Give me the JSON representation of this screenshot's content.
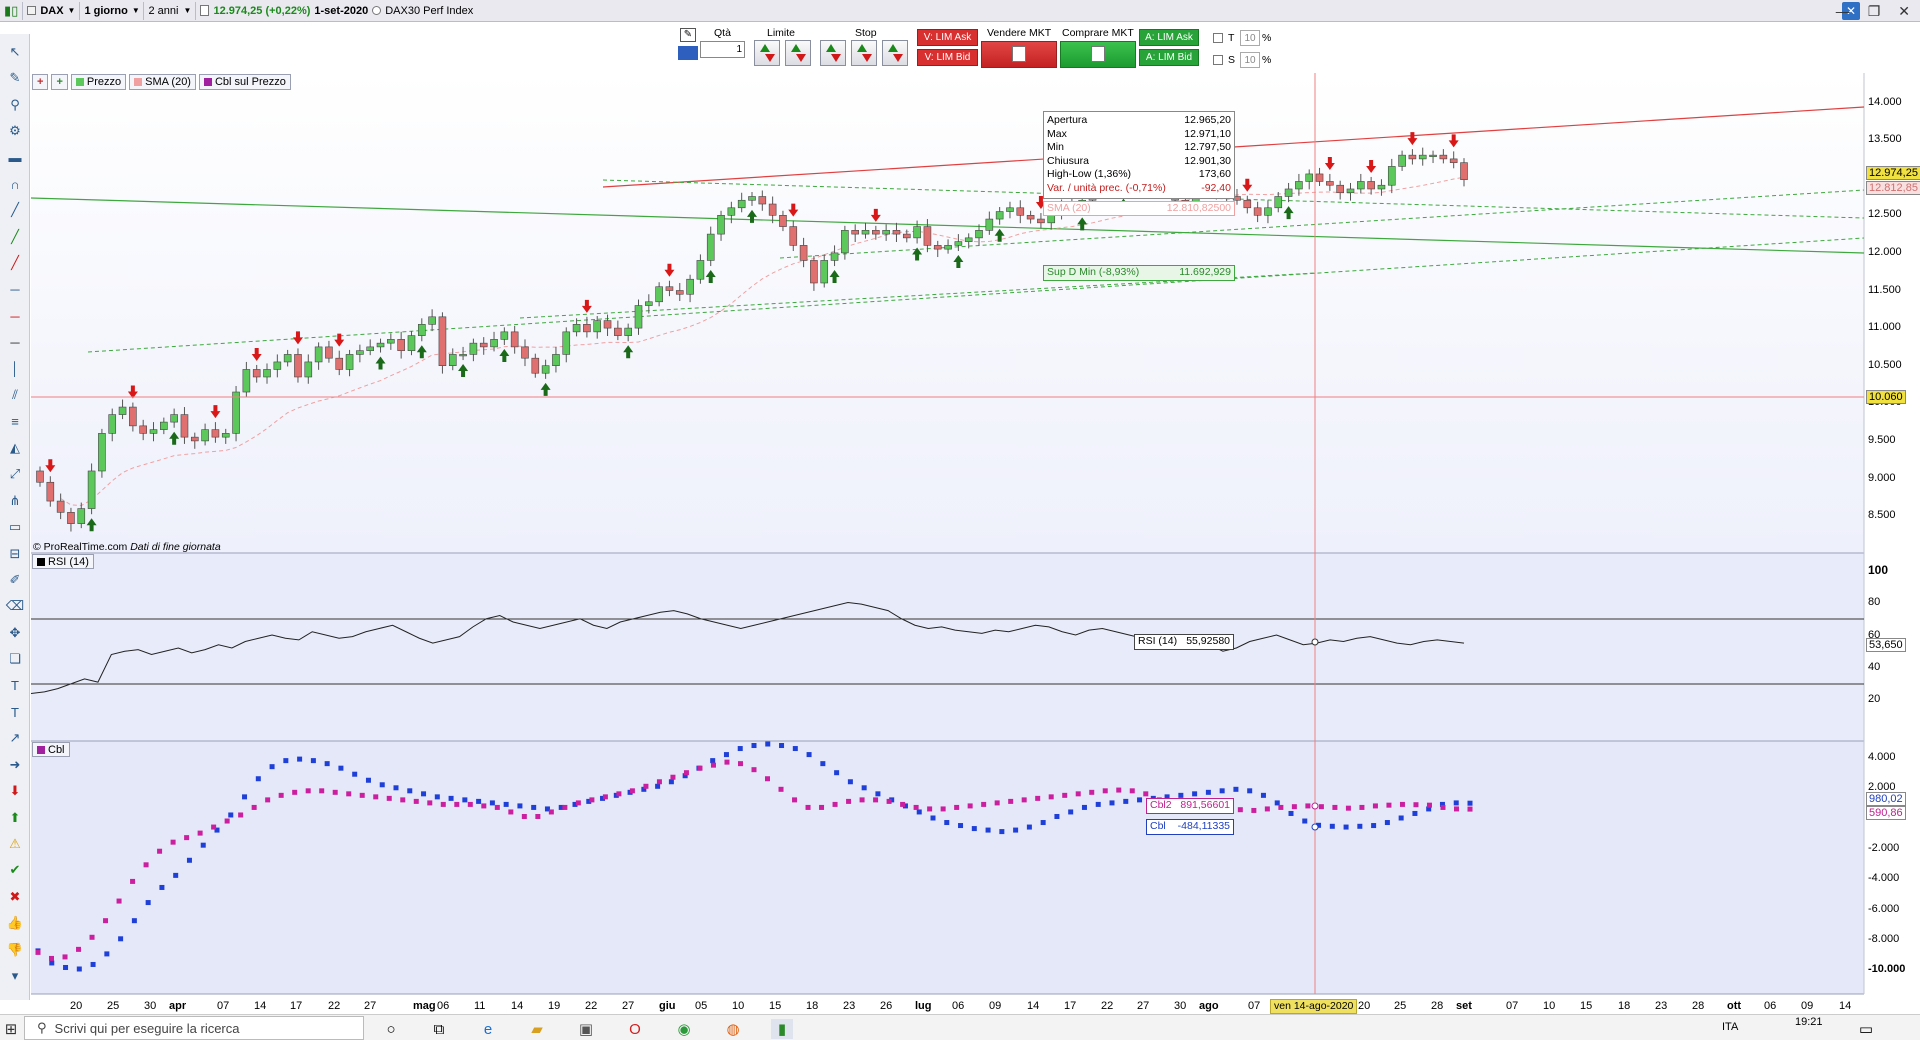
{
  "topbar": {
    "instrument": "DAX",
    "timeframe": "1 giorno",
    "period": "2 anni",
    "quote": "12.974,25 (+0,22%)",
    "date": "1-set-2020",
    "index_name": "DAX30 Perf Index"
  },
  "order": {
    "qty_label": "Qtà",
    "qty_value": "1",
    "limit_label": "Limite",
    "stop_label": "Stop",
    "sell_lim_ask": "V: LIM Ask",
    "sell_lim_bid": "V: LIM Bid",
    "sell_mkt": "Vendere MKT",
    "buy_mkt": "Comprare MKT",
    "buy_lim_ask": "A: LIM Ask",
    "buy_lim_bid": "A: LIM Bid",
    "t_label": "T",
    "s_label": "S",
    "t_value": "10",
    "s_value": "10",
    "pct": "%"
  },
  "legend": {
    "price": "Prezzo",
    "sma": "SMA (20)",
    "cbl_price": "Cbl sul Prezzo",
    "rsi": "RSI (14)",
    "cbl": "Cbl",
    "watermark": "© ProRealTime.com",
    "eod": "Dati di fine giornata"
  },
  "infobox": {
    "rows": [
      {
        "k": "Apertura",
        "v": "12.965,20"
      },
      {
        "k": "Max",
        "v": "12.971,10"
      },
      {
        "k": "Min",
        "v": "12.797,50"
      },
      {
        "k": "Chiusura",
        "v": "12.901,30"
      },
      {
        "k": "High-Low (1,36%)",
        "v": "173,60"
      },
      {
        "k": "Var. / unità prec. (-0,71%)",
        "v": "-92,40"
      }
    ],
    "sma_label": "SMA (20)",
    "sma_value": "12.810,82500",
    "sup_label": "Sup D Min (-8,93%)",
    "sup_value": "11.692,929",
    "rsi_label": "RSI (14)",
    "rsi_value": "55,92580",
    "cbl2_label": "Cbl2",
    "cbl2_value": "891,56601",
    "cbl_label": "Cbl",
    "cbl_value": "-484,11335",
    "cursor_date": "ven 14-ago-2020"
  },
  "axes": {
    "price_ticks": [
      "14.000",
      "13.500",
      "13.000",
      "12.500",
      "12.000",
      "11.500",
      "11.000",
      "10.500",
      "10.000",
      "9.500",
      "9.000",
      "8.500"
    ],
    "last_price": "12.974,25",
    "sma_tag": "12.812,85",
    "hline_tag": "10.060",
    "rsi_ticks": [
      "100",
      "80",
      "60",
      "40",
      "20"
    ],
    "rsi_tag": "53,650",
    "cbl_ticks": [
      "4.000",
      "2.000",
      "0",
      "-2.000",
      "-4.000",
      "-6.000",
      "-8.000",
      "-10.000"
    ],
    "cbl_tag1": "980,02",
    "cbl_tag2": "590,86",
    "dates": [
      "20",
      "25",
      "30",
      "apr",
      "07",
      "14",
      "17",
      "22",
      "27",
      "mag",
      "06",
      "11",
      "14",
      "19",
      "22",
      "27",
      "giu",
      "05",
      "10",
      "15",
      "18",
      "23",
      "26",
      "lug",
      "06",
      "09",
      "14",
      "17",
      "22",
      "27",
      "30",
      "ago",
      "07",
      "20",
      "25",
      "28",
      "set",
      "07",
      "10",
      "15",
      "18",
      "23",
      "28",
      "ott",
      "06",
      "09",
      "14"
    ]
  },
  "taskbar": {
    "search_placeholder": "Scrivi qui per eseguire la ricerca",
    "lang": "ITA",
    "time": "19:21"
  },
  "colors": {
    "bull": "#5cc85c",
    "bear": "#e07070",
    "sma": "#f0a0a0",
    "blue_dots": "#1e3fd8",
    "magenta_dots": "#cc1fa0",
    "trend_red": "#e04040",
    "trend_green": "#3ea83e"
  }
}
